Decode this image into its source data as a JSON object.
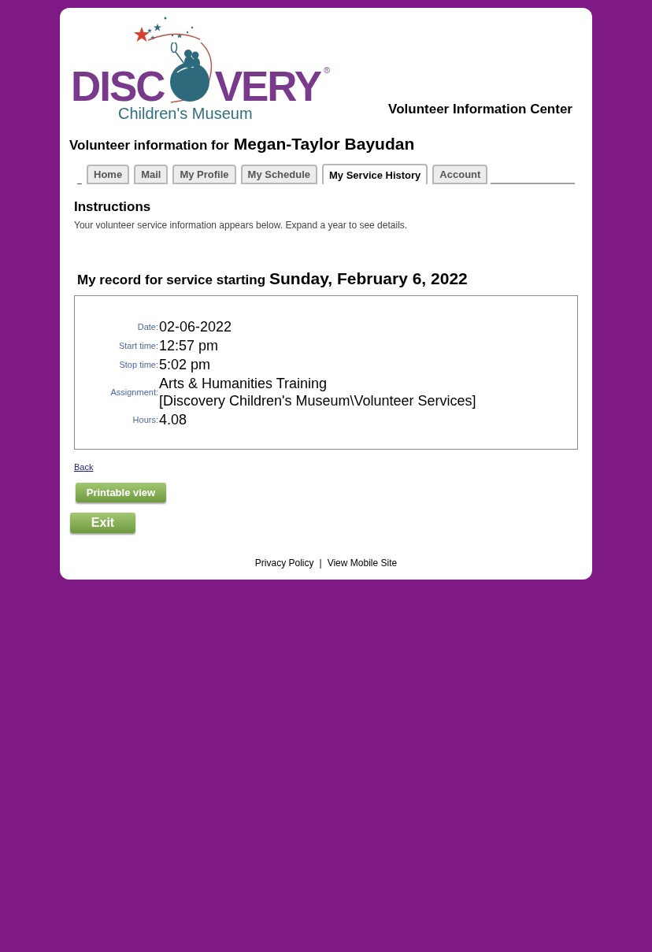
{
  "logo": {
    "wordmark_start": "DISC",
    "wordmark_end": "VERY",
    "registered_mark": "®",
    "subtitle": "Children's Museum"
  },
  "header": {
    "title": "Volunteer Information Center"
  },
  "volunteer": {
    "label": "Volunteer information for",
    "name": "Megan-Taylor Bayudan"
  },
  "tabs": [
    {
      "label": "Home",
      "selected": false
    },
    {
      "label": "Mail",
      "selected": false
    },
    {
      "label": "My Profile",
      "selected": false
    },
    {
      "label": "My Schedule",
      "selected": false
    },
    {
      "label": "My Service History",
      "selected": true
    },
    {
      "label": "Account",
      "selected": false
    }
  ],
  "instructions": {
    "heading": "Instructions",
    "text": "Your volunteer service information appears below. Expand a year to see details."
  },
  "record": {
    "label": "My record for service starting",
    "date": "Sunday, February 6, 2022",
    "fields": [
      {
        "label": "Date:",
        "value": "02-06-2022"
      },
      {
        "label": "Start time:",
        "value": "12:57 pm"
      },
      {
        "label": "Stop time:",
        "value": "5:02 pm"
      },
      {
        "label": "Assignment:",
        "value": "Arts & Humanities Training",
        "detail": "[Discovery Children's Museum\\Volunteer Services]"
      },
      {
        "label": "Hours:",
        "value": "4.08"
      }
    ]
  },
  "back_link": "Back",
  "buttons": [
    {
      "kind": "printable",
      "label": "Printable view"
    },
    {
      "kind": "exit",
      "label": "Exit"
    }
  ],
  "footer": {
    "links": [
      "Privacy Policy",
      "View Mobile Site"
    ],
    "separator": "|"
  }
}
